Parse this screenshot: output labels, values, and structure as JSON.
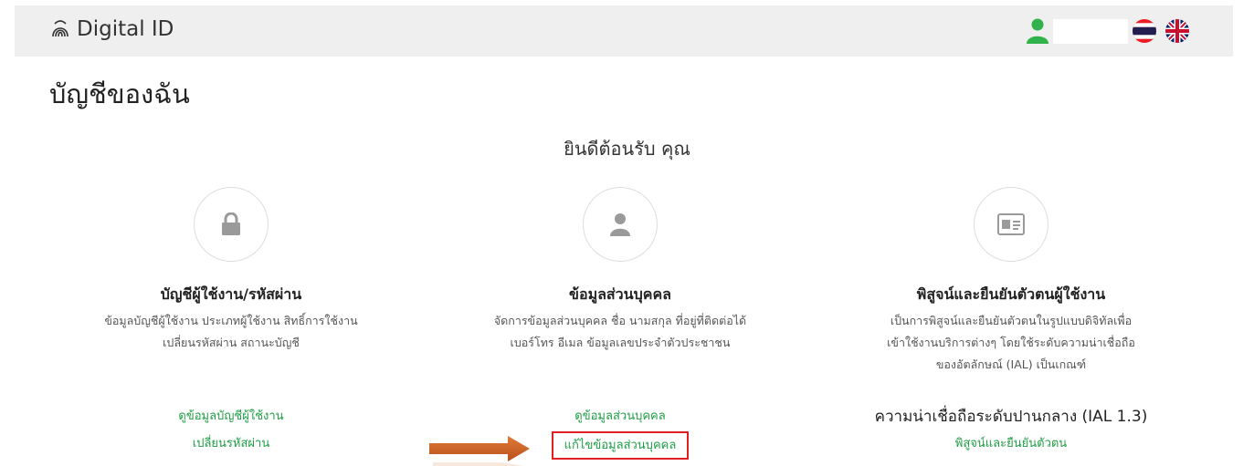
{
  "header": {
    "brand": "Digital ID",
    "user_name": ""
  },
  "page": {
    "title": "บัญชีของฉัน",
    "welcome": "ยินดีต้อนรับ คุณ"
  },
  "cards": [
    {
      "icon": "lock-icon",
      "title": "บัญชีผู้ใช้งาน/รหัสผ่าน",
      "desc_line1": "ข้อมูลบัญชีผู้ใช้งาน ประเภทผู้ใช้งาน สิทธิ์การใช้งาน",
      "desc_line2": "เปลี่ยนรหัสผ่าน สถานะบัญชี",
      "links": [
        "ดูข้อมูลบัญชีผู้ใช้งาน",
        "เปลี่ยนรหัสผ่าน"
      ]
    },
    {
      "icon": "user-icon",
      "title": "ข้อมูลส่วนบุคคล",
      "desc_line1": "จัดการข้อมูลส่วนบุคคล ชื่อ นามสกุล ที่อยู่ที่ติดต่อได้",
      "desc_line2": "เบอร์โทร อีเมล ข้อมูลเลขประจำตัวประชาชน",
      "links": [
        "ดูข้อมูลส่วนบุคคล",
        "แก้ไขข้อมูลส่วนบุคคล"
      ]
    },
    {
      "icon": "id-card-icon",
      "title": "พิสูจน์และยืนยันตัวตนผู้ใช้งาน",
      "desc_line1": "เป็นการพิสูจน์และยืนยันตัวตนในรูปแบบดิจิทัลเพื่อ",
      "desc_line2": "เข้าใช้งานบริการต่างๆ โดยใช้ระดับความน่าเชื่อถือ",
      "desc_line3": "ของอัตลักษณ์ (IAL) เป็นเกณฑ์",
      "ial_level": "ความน่าเชื่อถือระดับปานกลาง (IAL 1.3)",
      "links": [
        "พิสูจน์และยืนยันตัวตน"
      ]
    }
  ],
  "colors": {
    "link": "#1f9e45",
    "user_icon": "#2fb34a",
    "highlight": "#e02020",
    "arrow": "#d9692a"
  }
}
